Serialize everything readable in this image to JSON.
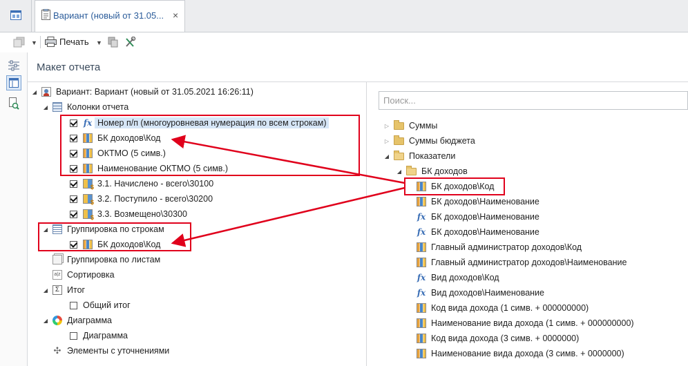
{
  "tab": {
    "title": "Вариант (новый от 31.05...",
    "close": "×"
  },
  "toolbar": {
    "print_label": "Печать"
  },
  "section": {
    "title": "Макет отчета"
  },
  "left_tree": {
    "root": "Вариант: Вариант (новый от 31.05.2021 16:26:11)",
    "columns_title": "Колонки отчета",
    "columns": [
      "Номер п/п (многоуровневая нумерация по всем строкам)",
      "БК доходов\\Код",
      "ОКТМО (5 симв.)",
      "Наименование ОКТМО (5 симв.)",
      "3.1. Начислено - всего\\30100",
      "3.2. Поступило - всего\\30200",
      "3.3. Возмещено\\30300"
    ],
    "row_grouping": "Группировка по строкам",
    "row_grouping_item": "БК доходов\\Код",
    "sheet_grouping": "Группировка по листам",
    "sorting": "Сортировка",
    "total": "Итог",
    "total_item": "Общий итог",
    "chart": "Диаграмма",
    "chart_item": "Диаграмма",
    "refinements": "Элементы с уточнениями"
  },
  "search": {
    "placeholder": "Поиск..."
  },
  "right_tree": {
    "folders": [
      "Суммы",
      "Суммы бюджета",
      "Показатели",
      "БК доходов"
    ],
    "items": [
      "БК доходов\\Код",
      "БК доходов\\Наименование",
      "БК доходов\\Наименование",
      "Главный администратор доходов\\Код",
      "Главный администратор доходов\\Наименование",
      "Вид доходов\\Код",
      "Вид доходов\\Наименование",
      "Код вида дохода (1 симв. + 000000000)",
      "Наименование вида дохода (1 симв. + 000000000)",
      "Код вида дохода (3 симв. + 0000000)",
      "Наименование вида дохода (3 симв. + 0000000)"
    ]
  },
  "colors": {
    "accent": "#2b5c9a",
    "annotation": "#e0001b",
    "selection": "#d6e6f7"
  }
}
